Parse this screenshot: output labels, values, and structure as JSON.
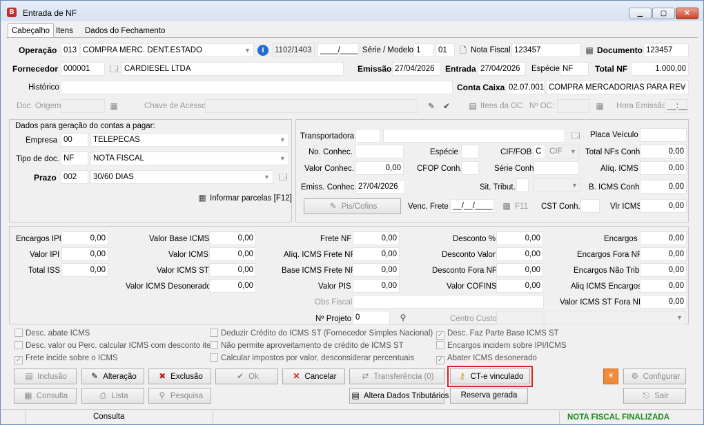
{
  "window": {
    "title": "Entrada de NF",
    "icon_letter": "B",
    "min": "▁",
    "max": "▢",
    "close": "✕"
  },
  "tabs": [
    "Cabeçalho",
    "Itens",
    "Dados do Fechamento"
  ],
  "header": {
    "operacao_label": "Operação",
    "operacao_code": "013",
    "operacao_desc": "COMPRA MERC. DENT.ESTADO",
    "cfop": "1102/1403",
    "cfop2": "____/____",
    "serie_label": "Série / Modelo",
    "serie": "1",
    "modelo": "01",
    "nota_label": "Nota Fiscal",
    "nota": "123457",
    "documento_label": "Documento",
    "documento": "123457",
    "fornecedor_label": "Fornecedor",
    "fornecedor_code": "000001",
    "fornecedor_name": "CARDIESEL LTDA",
    "emissao_label": "Emissão",
    "emissao": "27/04/2026",
    "entrada_label": "Entrada",
    "entrada": "27/04/2026",
    "especie_label": "Espécie",
    "especie": "NF",
    "totalnf_label": "Total NF",
    "totalnf": "1.000,00",
    "historico_label": "Histórico",
    "historico": "",
    "contacaixa_label": "Conta Caixa",
    "contacaixa_code": "02.07.001",
    "contacaixa_desc": "COMPRA MERCADORIAS PARA REV",
    "docorigem_label": "Doc. Origem",
    "chave_label": "Chave de Acesso",
    "itensoc_label": "Itens da OC",
    "noc_label": "Nº OC:",
    "horaemissao_label": "Hora Emissão",
    "horaemissao": "__:__"
  },
  "contas": {
    "title": "Dados para geração do contas a pagar:",
    "empresa_label": "Empresa",
    "empresa_code": "00",
    "empresa_desc": "TELEPECAS",
    "tipodoc_label": "Tipo de doc.",
    "tipodoc_code": "NF",
    "tipodoc_desc": "NOTA FISCAL",
    "prazo_label": "Prazo",
    "prazo_code": "002",
    "prazo_desc": "30/60 DIAS",
    "parcelas_label": "Informar parcelas [F12]"
  },
  "transp": {
    "transportadora_label": "Transportadora",
    "placa_label": "Placa Veículo",
    "noconhec_label": "No. Conhec.",
    "especie_label": "Espécie",
    "ciffob_label": "CIF/FOB",
    "ciffob_code": "C",
    "ciffob_desc": "CIF",
    "totalnfs_label": "Total NFs Conh.",
    "totalnfs": "0,00",
    "valorconhec_label": "Valor Conhec.",
    "valorconhec": "0,00",
    "cfopconh_label": "CFOP Conh.",
    "serieconh_label": "Série Conh.",
    "aliqicms_label": "Alíq. ICMS",
    "aliqicms": "0,00",
    "emissconhec_label": "Emiss. Conhec.",
    "emissconhec": "27/04/2026",
    "sittribut_label": "Sit. Tribut.",
    "bicmsconh_label": "B. ICMS Conh.",
    "bicmsconh": "0,00",
    "piscofins_label": "Pis/Cofins",
    "vencfrete_label": "Venc. Frete",
    "vencfrete": "__/__/____",
    "f11_label": "F11",
    "cstconh_label": "CST Conh.",
    "vlricms_label": "Vlr ICMS",
    "vlricms": "0,00"
  },
  "totais": {
    "encargosipi_label": "Encargos IPI",
    "encargosipi": "0,00",
    "valoripi_label": "Valor IPI",
    "valoripi": "0,00",
    "totaliss_label": "Total ISS",
    "totaliss": "0,00",
    "valorbaseicms_label": "Valor Base ICMS",
    "valorbaseicms": "0,00",
    "valoricms_label": "Valor ICMS",
    "valoricms": "0,00",
    "valoricmsst_label": "Valor ICMS ST",
    "valoricmsst": "0,00",
    "valoricmsdes_label": "Valor ICMS Desonerado",
    "valoricmsdes": "0,00",
    "fretenf_label": "Frete NF",
    "fretenf": "0,00",
    "aliqicmsfrete_label": "Alíq. ICMS Frete NF",
    "aliqicmsfrete": "0,00",
    "baseicmsfrete_label": "Base ICMS Frete NF",
    "baseicmsfrete": "0,00",
    "valorpis_label": "Valor PIS",
    "valorpis": "0,00",
    "obsfiscal_label": "Obs Fiscal",
    "nprojeto_label": "Nº Projeto",
    "nprojeto": "0",
    "desconto_label": "Desconto %",
    "desconto": "0,00",
    "descontovalor_label": "Desconto Valor",
    "descontovalor": "0,00",
    "descontofora_label": "Desconto Fora NF",
    "descontofora": "0,00",
    "valorcofins_label": "Valor COFINS",
    "valorcofins": "0,00",
    "centrocusto_label": "Centro Custo",
    "encargos_label": "Encargos",
    "encargos": "0,00",
    "encargosfora_label": "Encargos Fora NF",
    "encargosfora": "0,00",
    "encargosnaotrib_label": "Encargos Não Trib.",
    "encargosnaotrib": "0,00",
    "aliqicmsencargos_label": "Aliq ICMS Encargos",
    "aliqicmsencargos": "0,00",
    "valoricmsstfora_label": "Valor ICMS ST Fora NF",
    "valoricmsstfora": "0,00"
  },
  "checks": [
    "Desc. abate ICMS",
    "Desc. valor ou Perc. calcular ICMS com desconto item",
    "Frete incide sobre o ICMS",
    "Deduzir Crédito do ICMS ST (Fornecedor Simples Nacional)",
    "Não permite aproveitamento de crédito de ICMS ST",
    "Calcular impostos por valor, desconsiderar percentuais",
    "Desc. Faz Parte Base ICMS ST",
    "Encargos incidem sobre IPI/ICMS",
    "Abater ICMS desonerado"
  ],
  "buttons": {
    "inclusao": "Inclusão",
    "alteracao": "Alteração",
    "exclusao": "Exclusão",
    "ok": "Ok",
    "cancelar": "Cancelar",
    "transferencia": "Transferência (0)",
    "ctevinculado": "CT-e vinculado",
    "configurar": "Configurar",
    "consulta": "Consulta",
    "lista": "Lista",
    "pesquisa": "Pesquisa",
    "alteradados": "Altera Dados Tributários",
    "reserva": "Reserva gerada",
    "sair": "Sair"
  },
  "status": {
    "mode": "Consulta",
    "nf_status": "NOTA FISCAL FINALIZADA",
    "nf_status_color": "#1a8a1a"
  },
  "colors": {
    "highlight": "#e02020"
  }
}
